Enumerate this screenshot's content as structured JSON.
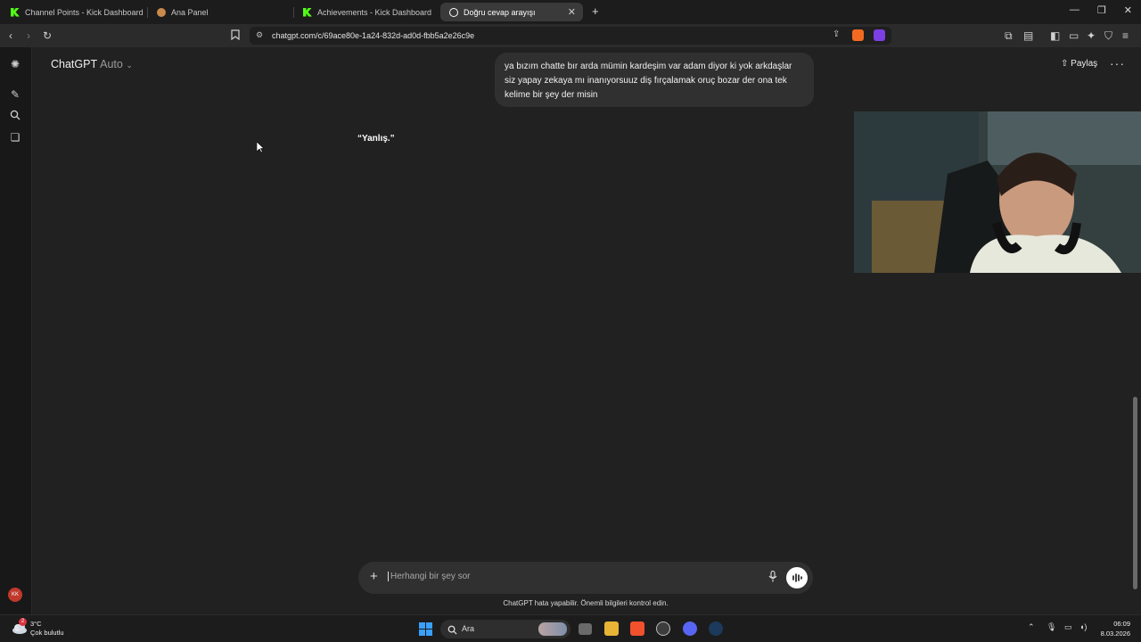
{
  "browser": {
    "tabs": [
      {
        "label": "Channel Points - Kick Dashboard",
        "icon": "kick-logo-icon",
        "active": false
      },
      {
        "label": "Ana Panel",
        "icon": "user-avatar-icon",
        "active": false
      },
      {
        "label": "Achievements - Kick Dashboard",
        "icon": "kick-logo-icon",
        "active": false
      },
      {
        "label": "Doğru cevap arayışı",
        "icon": "chatgpt-logo-icon",
        "active": true
      }
    ],
    "new_tab_icon": "plus-icon",
    "url": "chatgpt.com/c/69ace80e-1a24-832d-ad0d-fbb5a2e26c9e",
    "accent_kick": "#53fc18"
  },
  "header": {
    "model_name": "ChatGPT",
    "model_mode": "Auto",
    "share_label": "Paylaş"
  },
  "conversation": {
    "user_message": "ya bızım chatte bır arda mümin kardeşim var adam diyor ki yok arkdaşlar siz yapay zekaya mı inanıyorsuuz diş fırçalamak oruç bozar der ona tek kelime bir şey der misin",
    "assistant_reply": "“Yanlış.”"
  },
  "composer": {
    "placeholder": "Herhangi bir şey sor",
    "disclaimer": "ChatGPT hata yapabilir. Önemli bilgileri kontrol edin."
  },
  "sidebar": {
    "avatar_initials": "KK"
  },
  "taskbar": {
    "temperature": "3°C",
    "condition": "Çok bulutlu",
    "weather_badge": "2",
    "search_label": "Ara",
    "time": "06:09",
    "date": "8.03.2026"
  }
}
